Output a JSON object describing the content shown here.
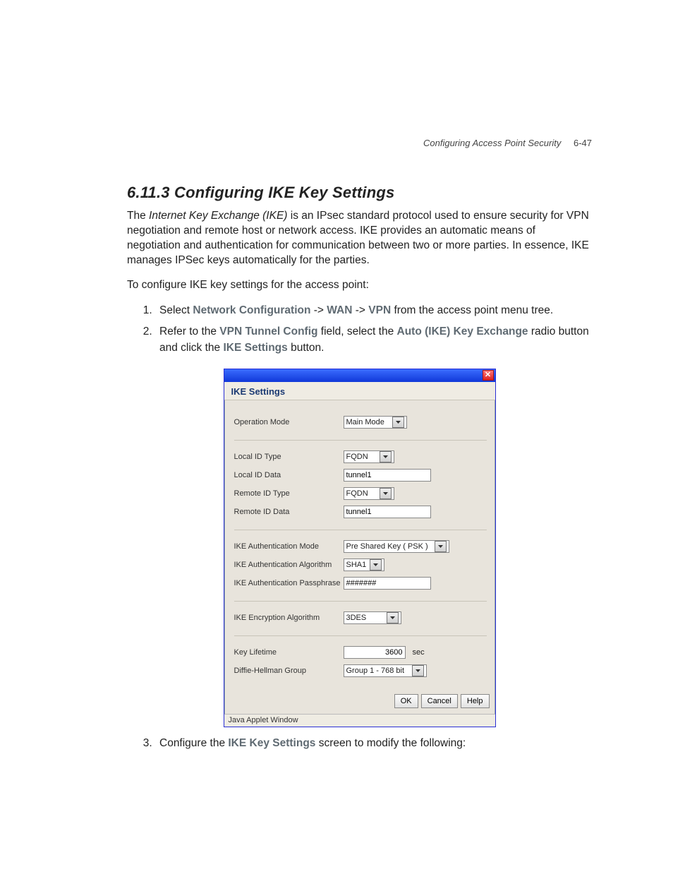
{
  "header": {
    "chapter": "Configuring Access Point Security",
    "pagenum": "6-47"
  },
  "section": {
    "title": "6.11.3  Configuring IKE Key Settings"
  },
  "p1_pre": "The ",
  "p1_em": "Internet Key Exchange (IKE)",
  "p1_post": " is an IPsec standard protocol used to ensure security for VPN negotiation and remote host or network access. IKE provides an automatic means of negotiation and authentication for communication between two or more parties. In essence, IKE manages IPSec keys automatically for the parties.",
  "p2": "To configure IKE key settings for the access point:",
  "step1": {
    "pre": "Select ",
    "a": "Network Configuration",
    "sep1": " -> ",
    "b": "WAN",
    "sep2": " -> ",
    "c": "VPN",
    "post": " from the access point menu tree."
  },
  "step2": {
    "pre": "Refer to the ",
    "a": "VPN Tunnel Config",
    "mid1": " field, select the ",
    "b": "Auto (IKE) Key Exchange",
    "mid2": " radio button and click the ",
    "c": "IKE Settings",
    "post": " button."
  },
  "step3": {
    "pre": "Configure the ",
    "a": "IKE Key Settings",
    "post": " screen to modify the following:"
  },
  "dialog": {
    "close_glyph": "✕",
    "title": "IKE Settings",
    "labels": {
      "op_mode": "Operation Mode",
      "local_id_type": "Local ID Type",
      "local_id_data": "Local ID Data",
      "remote_id_type": "Remote ID Type",
      "remote_id_data": "Remote ID Data",
      "auth_mode": "IKE Authentication Mode",
      "auth_algo": "IKE Authentication Algorithm",
      "auth_pass": "IKE Authentication Passphrase",
      "enc_algo": "IKE Encryption Algorithm",
      "key_life": "Key Lifetime",
      "dh_group": "Diffie-Hellman Group"
    },
    "values": {
      "op_mode": "Main Mode",
      "local_id_type": "FQDN",
      "local_id_data": "tunnel1",
      "remote_id_type": "FQDN",
      "remote_id_data": "tunnel1",
      "auth_mode": "Pre Shared Key ( PSK )",
      "auth_algo": "SHA1",
      "auth_pass": "#######",
      "enc_algo": "3DES",
      "key_life": "3600",
      "key_life_unit": "sec",
      "dh_group": "Group 1 - 768 bit"
    },
    "buttons": {
      "ok": "OK",
      "cancel": "Cancel",
      "help": "Help"
    },
    "status": "Java Applet Window"
  }
}
